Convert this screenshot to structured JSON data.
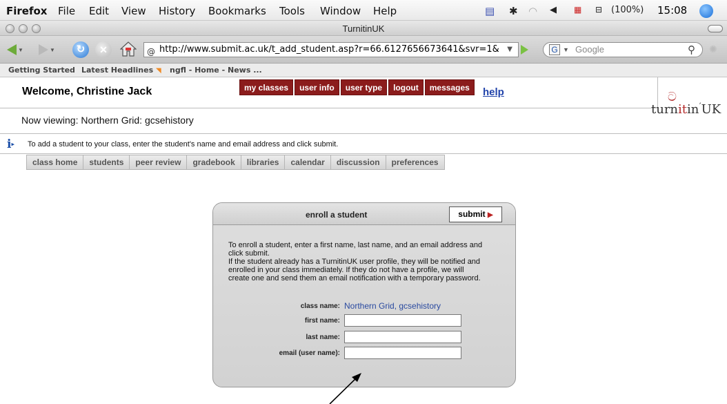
{
  "menubar": {
    "app": "Firefox",
    "items": [
      "File",
      "Edit",
      "View",
      "History",
      "Bookmarks",
      "Tools",
      "Window",
      "Help"
    ],
    "battery": "(100%)",
    "clock": "15:08"
  },
  "window": {
    "title": "TurnitinUK"
  },
  "toolbar": {
    "url": "http://www.submit.ac.uk/t_add_student.asp?r=66.6127656673641&svr=1&",
    "search_placeholder": "Google"
  },
  "bookmarks": [
    "Getting Started",
    "Latest Headlines",
    "ngfl - Home - News ..."
  ],
  "header": {
    "welcome": "Welcome, Christine Jack",
    "nav": [
      "my classes",
      "user info",
      "user type",
      "logout",
      "messages"
    ],
    "help": "help",
    "logo_pre": "turn",
    "logo_it": "it",
    "logo_post": "in",
    "logo_uk": "UK"
  },
  "now_viewing": "Now viewing: Northern Grid: gcsehistory",
  "info_text": "To add a student to your class, enter the student's name and email address and click submit.",
  "tabs": [
    "class home",
    "students",
    "peer review",
    "gradebook",
    "libraries",
    "calendar",
    "discussion",
    "preferences"
  ],
  "panel": {
    "title": "enroll a student",
    "submit": "submit",
    "desc_lines": [
      "To enroll a student, enter a first name, last name, and an email address and",
      "click submit.",
      "If the student already has a TurnitinUK user profile, they will be notified and",
      "enrolled in your class immediately. If they do not have a profile, we will",
      "create one and send them an email notification with a temporary password."
    ],
    "class_name_label": "class name:",
    "class_name_value": "Northern Grid, gcsehistory",
    "first_name_label": "first name:",
    "last_name_label": "last name:",
    "email_label": "email (user name):"
  }
}
